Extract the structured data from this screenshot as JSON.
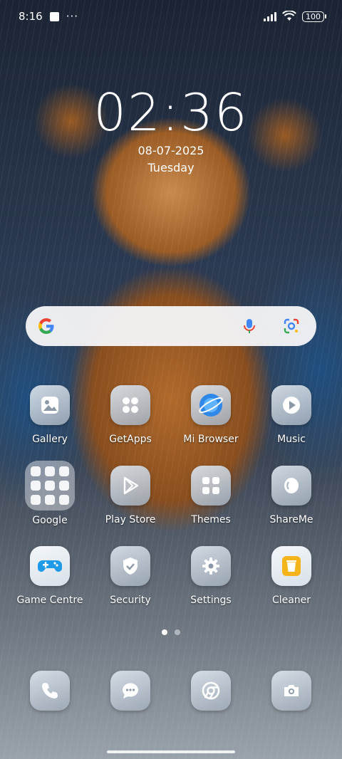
{
  "status_bar": {
    "time": "8:16",
    "more": "···",
    "battery": "100"
  },
  "clock": {
    "time": "02:36",
    "date": "08-07-2025",
    "day": "Tuesday"
  },
  "search": {
    "engine": "Google"
  },
  "apps": [
    {
      "label": "Gallery",
      "icon": "gallery-icon"
    },
    {
      "label": "GetApps",
      "icon": "getapps-icon"
    },
    {
      "label": "Mi Browser",
      "icon": "mi-browser-icon"
    },
    {
      "label": "Music",
      "icon": "music-icon"
    },
    {
      "label": "Google",
      "icon": "google-folder-icon"
    },
    {
      "label": "Play Store",
      "icon": "play-store-icon"
    },
    {
      "label": "Themes",
      "icon": "themes-icon"
    },
    {
      "label": "ShareMe",
      "icon": "shareme-icon"
    },
    {
      "label": "Game Centre",
      "icon": "game-centre-icon"
    },
    {
      "label": "Security",
      "icon": "security-icon"
    },
    {
      "label": "Settings",
      "icon": "settings-icon"
    },
    {
      "label": "Cleaner",
      "icon": "cleaner-icon"
    }
  ],
  "dock": [
    {
      "icon": "phone-icon"
    },
    {
      "icon": "messages-icon"
    },
    {
      "icon": "chrome-icon"
    },
    {
      "icon": "camera-icon"
    }
  ],
  "pager": {
    "pages": 2,
    "current": 1
  },
  "colors": {
    "accent_blue": "#2f88e8",
    "cleaner_yellow": "#f5b51a",
    "game_blue": "#1e9ae8"
  }
}
